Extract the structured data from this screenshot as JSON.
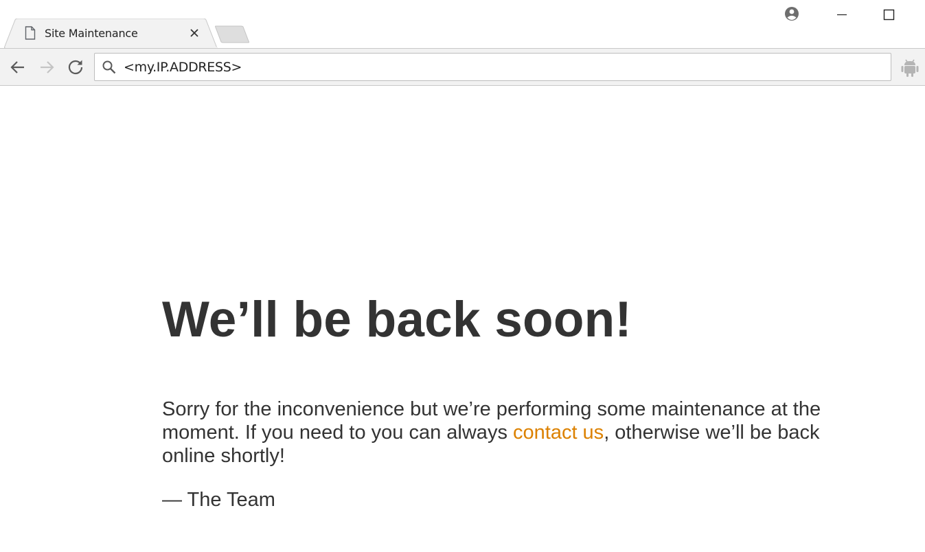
{
  "tab": {
    "title": "Site Maintenance",
    "favicon": "page-icon",
    "close": "close-icon"
  },
  "window": {
    "controls": [
      "profile-icon",
      "minimize-icon",
      "maximize-icon"
    ]
  },
  "toolbar": {
    "address": "<my.IP.ADDRESS>",
    "icons": [
      "back-arrow-icon",
      "forward-arrow-icon",
      "reload-icon",
      "search-icon",
      "android-extension-icon"
    ]
  },
  "page": {
    "headline": "We’ll be back soon!",
    "message_before_link": "Sorry for the inconvenience but we’re performing some maintenance at the moment. If you need to you can always ",
    "link_text": "contact us",
    "message_after_link": ", otherwise we’ll be back online shortly!",
    "signature": "— The Team"
  },
  "colors": {
    "link": "#dc8100",
    "text": "#333333",
    "toolbar_bg": "#f2f2f2"
  }
}
